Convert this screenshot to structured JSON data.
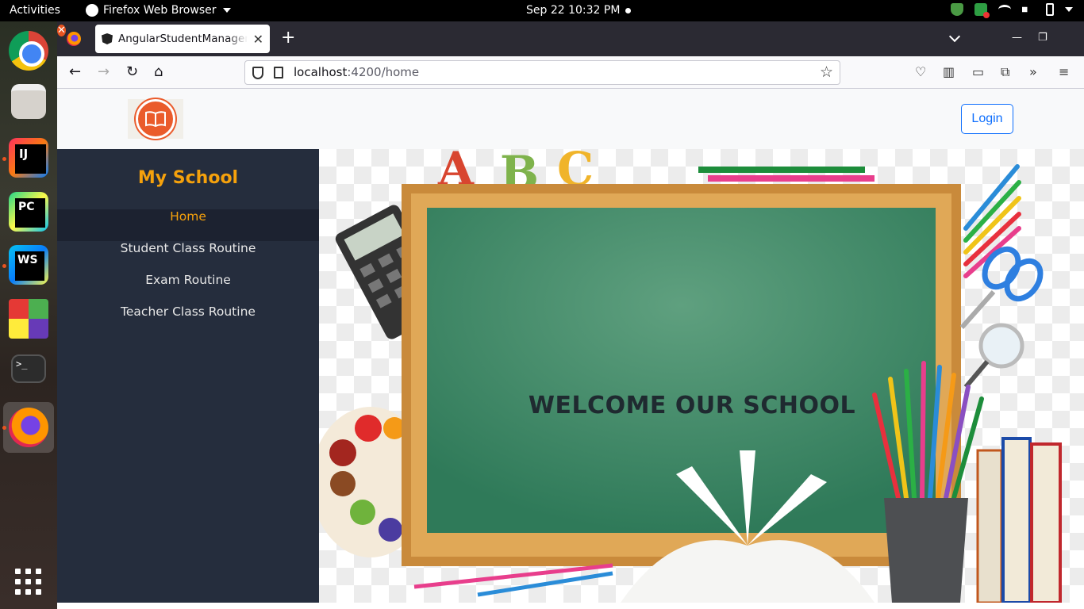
{
  "system_bar": {
    "activities": "Activities",
    "app_menu": "Firefox Web Browser",
    "clock": "Sep 22  10:32 PM"
  },
  "dock": {
    "items": [
      "chrome-icon",
      "files-icon",
      "intellij-icon",
      "pycharm-icon",
      "webstorm-icon",
      "grid-app-icon",
      "terminal-icon",
      "firefox-icon",
      "show-apps-icon"
    ],
    "terminal_glyph": ">_"
  },
  "browser": {
    "tab_title": "AngularStudentManagement",
    "url_host": "localhost",
    "url_path": ":4200/home"
  },
  "app": {
    "login_label": "Login",
    "brand": "My School",
    "menu": [
      {
        "label": "Home",
        "active": true
      },
      {
        "label": "Student Class Routine",
        "active": false
      },
      {
        "label": "Exam Routine",
        "active": false
      },
      {
        "label": "Teacher Class Routine",
        "active": false
      }
    ],
    "welcome_text": "WELCOME OUR SCHOOL"
  },
  "colors": {
    "accent_orange": "#f5a10c",
    "sidebar_bg": "#252d3d",
    "login_blue": "#0d6efd",
    "logo_orange": "#ea5b2b"
  }
}
